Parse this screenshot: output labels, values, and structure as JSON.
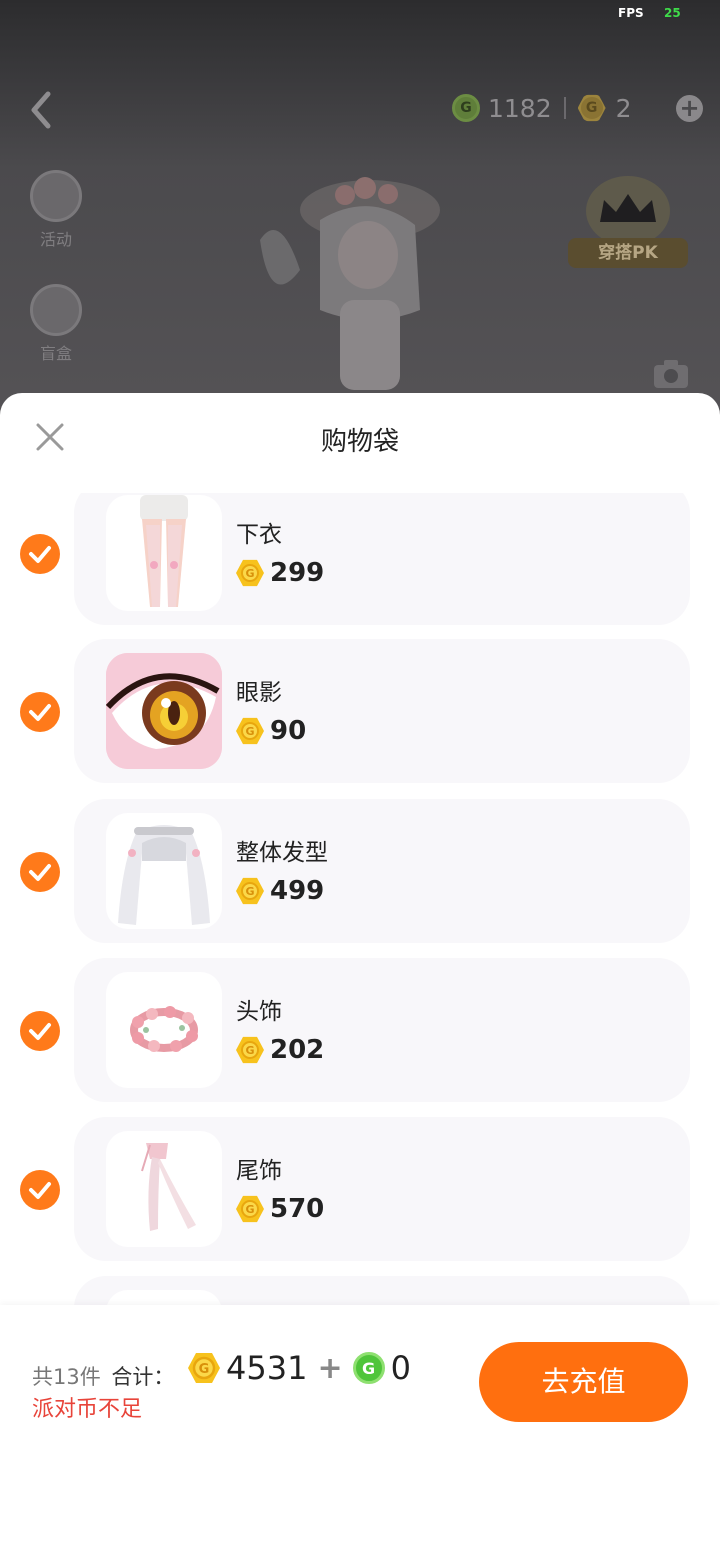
{
  "status": {
    "fps_label": "FPS",
    "fps_value": "25"
  },
  "topbar": {
    "green_coin_amount": "1182",
    "party_coin_amount": "2"
  },
  "side": {
    "activity_label": "活动",
    "mystery_label": "盲盒"
  },
  "pk": {
    "label": "穿搭PK"
  },
  "sheet": {
    "title": "购物袋",
    "items": [
      {
        "name": "下衣",
        "price": "299",
        "checked": true,
        "icon": "pants-thumbnail"
      },
      {
        "name": "眼影",
        "price": "90",
        "checked": true,
        "icon": "eye-thumbnail"
      },
      {
        "name": "整体发型",
        "price": "499",
        "checked": true,
        "icon": "hair-thumbnail"
      },
      {
        "name": "头饰",
        "price": "202",
        "checked": true,
        "icon": "flower-crown-thumbnail"
      },
      {
        "name": "尾饰",
        "price": "570",
        "checked": true,
        "icon": "tail-ribbon-thumbnail"
      }
    ]
  },
  "footer": {
    "count_text": "共13件",
    "total_label": "合计：",
    "total_party": "4531",
    "plus": "+",
    "total_green": "0",
    "warning": "派对币不足",
    "recharge_label": "去充值"
  },
  "colors": {
    "accent": "#ff6f0f",
    "check": "#ff7a1a",
    "warning": "#e8443a",
    "party_coin": "#f7c21d",
    "green_coin": "#4fc53a"
  }
}
